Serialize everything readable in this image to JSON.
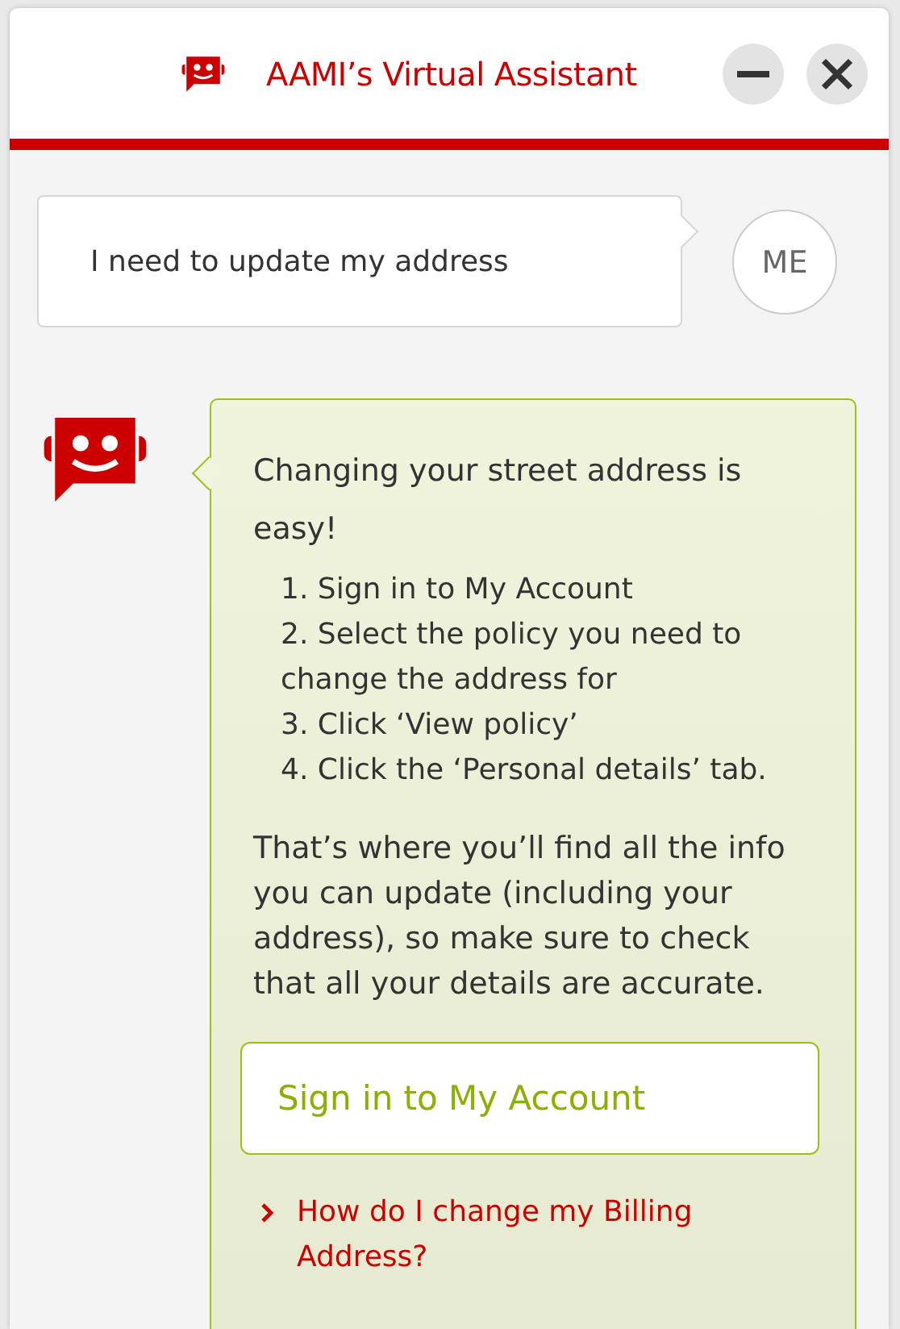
{
  "header": {
    "title": "AAMI’s Virtual Assistant",
    "buttons": [
      {
        "kind": "minimize"
      },
      {
        "kind": "close"
      }
    ]
  },
  "messages": [
    {
      "kind": "user",
      "text": "I need to update my address",
      "avatar": "ME"
    },
    {
      "kind": "bot",
      "intro": "Changing your street address is easy!",
      "steps": [
        "1. Sign in to My Account",
        "2. Select the policy you need to change the address for",
        "3. Click ‘View policy’",
        "4. Click the ‘Personal details’ tab."
      ],
      "outro": "That’s where you’ll find all the info you can update (including your address), so make sure to check that all your details are accurate.",
      "button": "Sign in to My Account",
      "links": [
        "How do I change my Billing Address?"
      ]
    }
  ]
}
